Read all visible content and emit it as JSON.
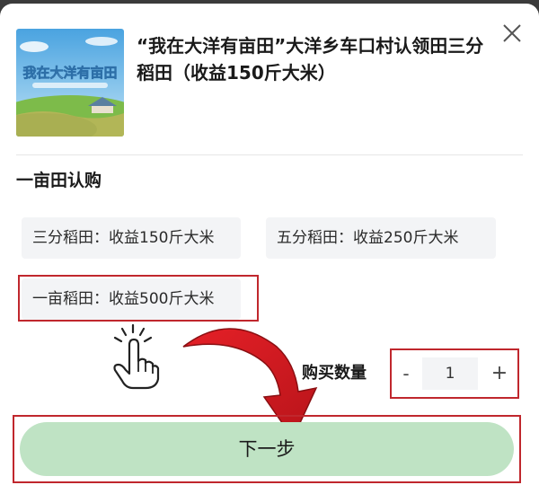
{
  "product": {
    "title": "“我在大洋有亩田”大洋乡车口村认领田三分稻田（收益150斤大米）",
    "thumbnail_logo_text": "我在大洋有亩田",
    "close_icon": "close-icon"
  },
  "section_title": "一亩田认购",
  "options": [
    {
      "label": "三分稻田：收益150斤大米"
    },
    {
      "label": "五分稻田：收益250斤大米"
    },
    {
      "label": "一亩稻田：收益500斤大米",
      "highlighted": true
    }
  ],
  "quantity": {
    "label": "购买数量",
    "value": "1",
    "minus": "-",
    "plus": "+"
  },
  "next_button": {
    "label": "下一步",
    "color": "#bfe3c4"
  },
  "annotations": {
    "hand_icon": "pointer-hand-icon",
    "arrow_icon": "red-curved-arrow-icon",
    "highlight_color": "#c0272d"
  }
}
